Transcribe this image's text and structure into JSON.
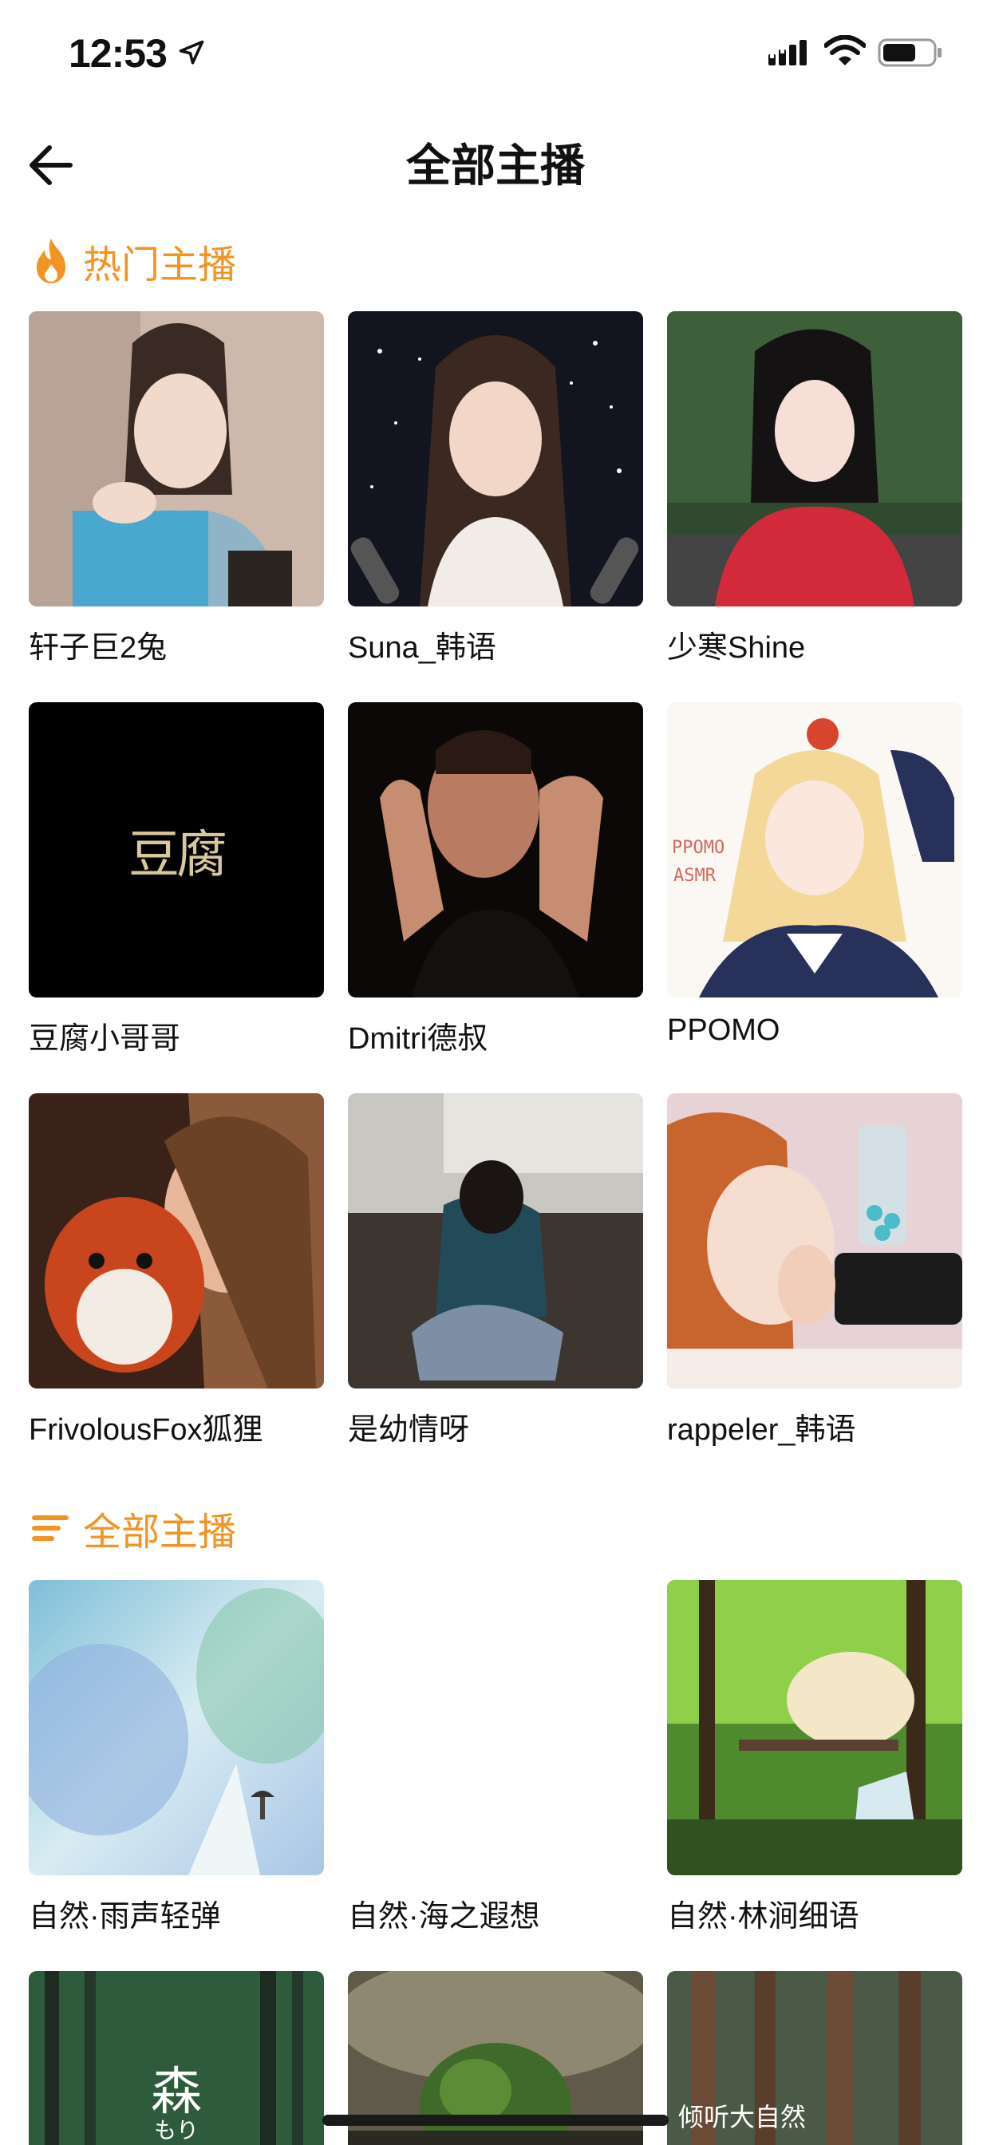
{
  "status_bar": {
    "time": "12:53"
  },
  "nav": {
    "title": "全部主播"
  },
  "hot_section": {
    "title": "热门主播",
    "items": [
      {
        "name": "轩子巨2兔"
      },
      {
        "name": "Suna_韩语"
      },
      {
        "name": "少寒Shine"
      },
      {
        "name": "豆腐小哥哥",
        "logo_text": "豆腐"
      },
      {
        "name": "Dmitri德叔"
      },
      {
        "name": "PPOMO",
        "art_text_1": "PPOMO",
        "art_text_2": "ASMR"
      },
      {
        "name": "FrivolousFox狐狸"
      },
      {
        "name": "是幼情呀"
      },
      {
        "name": "rappeler_韩语"
      }
    ]
  },
  "all_section": {
    "title": "全部主播",
    "items": [
      {
        "name": "自然·雨声轻弹"
      },
      {
        "name": "自然·海之遐想"
      },
      {
        "name": "自然·林涧细语"
      },
      {
        "name": "",
        "overlay_text": "森",
        "overlay_sub": "もり"
      },
      {
        "name": ""
      },
      {
        "name": "",
        "overlay_text": "倾听大自然"
      }
    ]
  },
  "colors": {
    "accent": "#f39322",
    "text": "#111111",
    "background": "#ffffff"
  }
}
